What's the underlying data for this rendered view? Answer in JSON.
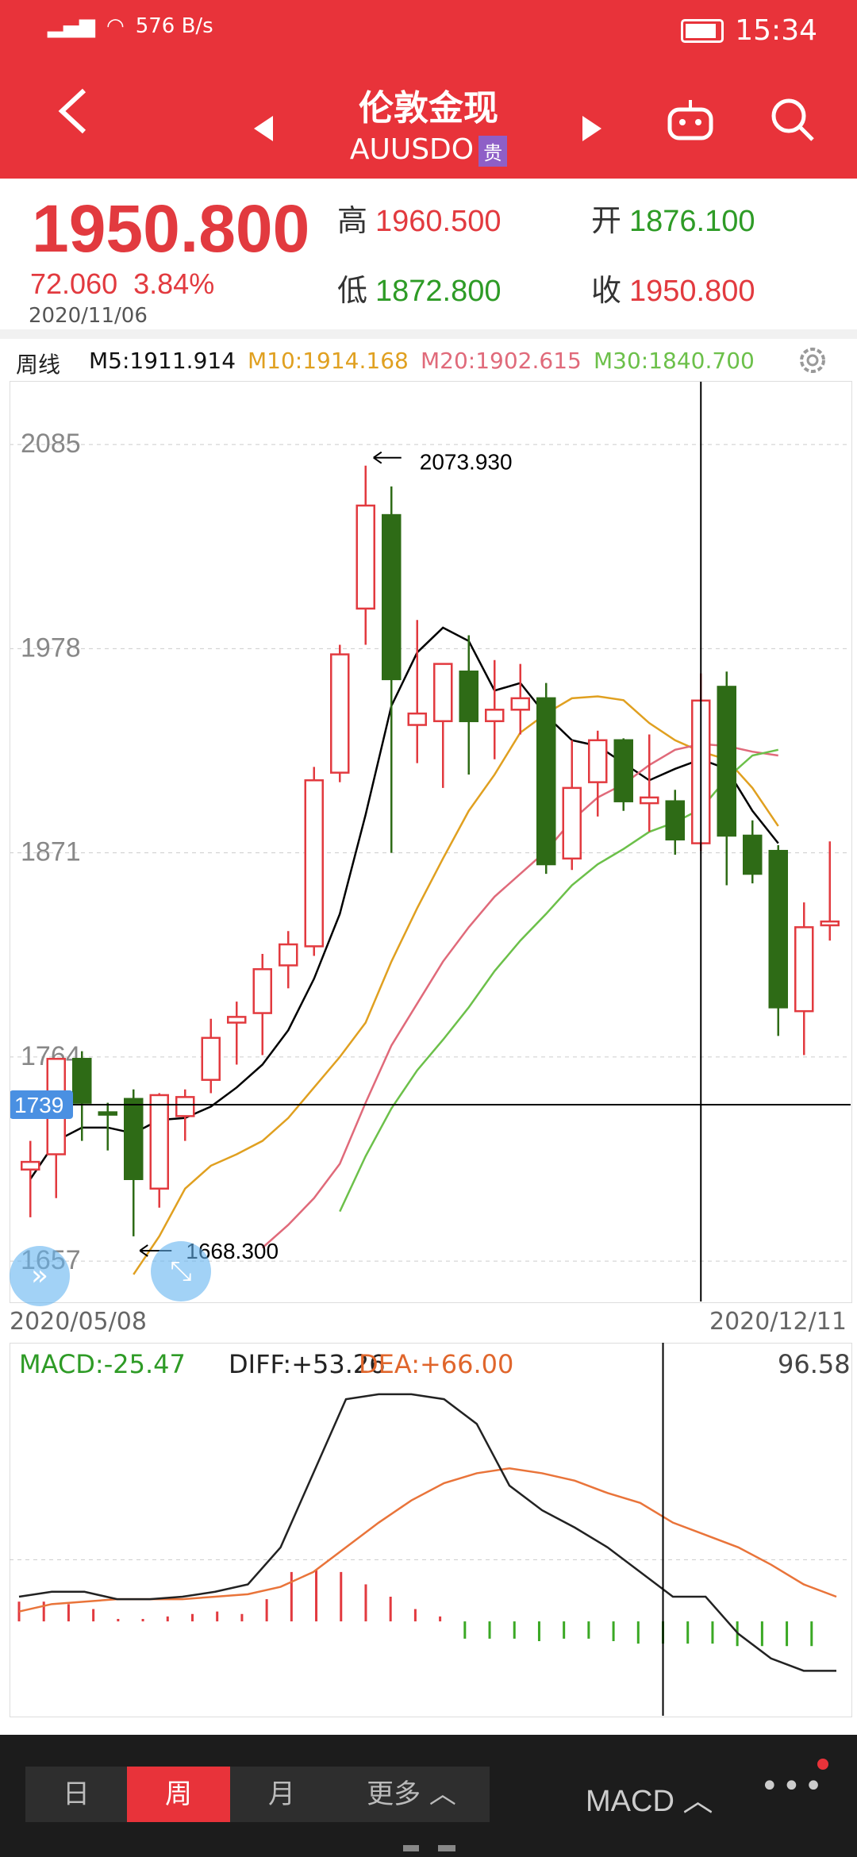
{
  "status": {
    "left_text": "576 B/s",
    "time": "15:34"
  },
  "header": {
    "title": "伦敦金现",
    "symbol": "AUUSDO",
    "badge": "贵"
  },
  "quote": {
    "last": "1950.800",
    "change": "72.060",
    "change_pct": "3.84%",
    "date": "2020/11/06",
    "high_label": "高",
    "high": "1960.500",
    "open_label": "开",
    "open": "1876.100",
    "low_label": "低",
    "low": "1872.800",
    "close_label": "收",
    "close": "1950.800"
  },
  "ma_bar": {
    "period": "周线",
    "m5": "M5:1911.914",
    "m10": "M10:1914.168",
    "m20": "M20:1902.615",
    "m30": "M30:1840.700"
  },
  "colors": {
    "brand": "#e8333a",
    "up": "#e23a3f",
    "down": "#2e6b16",
    "m5": "#000000",
    "m10": "#e0a020",
    "m20": "#e06a7a",
    "m30": "#6cc04a"
  },
  "chart_data": [
    {
      "type": "candlestick",
      "ylim": [
        1640,
        2110
      ],
      "y_ticks": [
        2085,
        1978,
        1871,
        1764,
        1657
      ],
      "x_start": "2020/05/08",
      "x_end": "2020/12/11",
      "crosshair_price": "1739",
      "max_label": "2073.930",
      "min_label": "1668.300",
      "candles": [
        {
          "o": 1705,
          "h": 1720,
          "l": 1680,
          "c": 1709
        },
        {
          "o": 1713,
          "h": 1760,
          "l": 1690,
          "c": 1763
        },
        {
          "o": 1763,
          "h": 1767,
          "l": 1720,
          "c": 1740
        },
        {
          "o": 1735,
          "h": 1740,
          "l": 1715,
          "c": 1734
        },
        {
          "o": 1742,
          "h": 1747,
          "l": 1670,
          "c": 1700
        },
        {
          "o": 1695,
          "h": 1745,
          "l": 1685,
          "c": 1744
        },
        {
          "o": 1733,
          "h": 1747,
          "l": 1720,
          "c": 1743
        },
        {
          "o": 1752,
          "h": 1784,
          "l": 1745,
          "c": 1774
        },
        {
          "o": 1782,
          "h": 1793,
          "l": 1760,
          "c": 1785
        },
        {
          "o": 1787,
          "h": 1818,
          "l": 1765,
          "c": 1810
        },
        {
          "o": 1812,
          "h": 1830,
          "l": 1800,
          "c": 1823
        },
        {
          "o": 1822,
          "h": 1916,
          "l": 1817,
          "c": 1909
        },
        {
          "o": 1913,
          "h": 1980,
          "l": 1908,
          "c": 1975
        },
        {
          "o": 1999,
          "h": 2073.93,
          "l": 1980,
          "c": 2053
        },
        {
          "o": 2048,
          "h": 2063,
          "l": 1871,
          "c": 1962
        },
        {
          "o": 1938,
          "h": 1993,
          "l": 1918,
          "c": 1944
        },
        {
          "o": 1940,
          "h": 1960,
          "l": 1905,
          "c": 1970
        },
        {
          "o": 1966,
          "h": 1985,
          "l": 1912,
          "c": 1940
        },
        {
          "o": 1940,
          "h": 1972,
          "l": 1920,
          "c": 1946
        },
        {
          "o": 1946,
          "h": 1970,
          "l": 1933,
          "c": 1952
        },
        {
          "o": 1952,
          "h": 1960,
          "l": 1860,
          "c": 1865
        },
        {
          "o": 1868,
          "h": 1930,
          "l": 1862,
          "c": 1905
        },
        {
          "o": 1908,
          "h": 1935,
          "l": 1890,
          "c": 1930
        },
        {
          "o": 1930,
          "h": 1931,
          "l": 1893,
          "c": 1898
        },
        {
          "o": 1897,
          "h": 1933,
          "l": 1882,
          "c": 1900
        },
        {
          "o": 1898,
          "h": 1904,
          "l": 1870,
          "c": 1878
        },
        {
          "o": 1876,
          "h": 1965,
          "l": 1872,
          "c": 1950.8
        },
        {
          "o": 1958,
          "h": 1966,
          "l": 1854,
          "c": 1880
        },
        {
          "o": 1880,
          "h": 1888,
          "l": 1855,
          "c": 1860
        },
        {
          "o": 1872,
          "h": 1875,
          "l": 1775,
          "c": 1790
        },
        {
          "o": 1788,
          "h": 1845,
          "l": 1765,
          "c": 1832
        },
        {
          "o": 1833,
          "h": 1877,
          "l": 1825,
          "c": 1835
        }
      ],
      "series": [
        {
          "name": "M5",
          "values": [
            1700,
            1720,
            1727,
            1727,
            1724,
            1731,
            1732,
            1738,
            1748,
            1760,
            1778,
            1805,
            1839,
            1891,
            1948,
            1976,
            1989,
            1982,
            1956,
            1960,
            1943,
            1930,
            1927,
            1918,
            1909,
            1915,
            1920,
            1915,
            1893,
            1876
          ]
        },
        {
          "name": "M10",
          "values": [
            null,
            null,
            null,
            null,
            1650,
            1670,
            1695,
            1707,
            1713,
            1720,
            1732,
            1748,
            1764,
            1782,
            1814,
            1842,
            1868,
            1893,
            1912,
            1934,
            1944,
            1952,
            1953,
            1951,
            1939,
            1930,
            1924,
            1920,
            1905,
            1885
          ]
        },
        {
          "name": "M20",
          "values": [
            null,
            null,
            null,
            null,
            null,
            null,
            null,
            null,
            null,
            1664,
            1676,
            1690,
            1708,
            1740,
            1770,
            1792,
            1814,
            1832,
            1848,
            1860,
            1872,
            1888,
            1900,
            1907,
            1917,
            1925,
            1928,
            1927,
            1924,
            1922
          ]
        },
        {
          "name": "M30",
          "values": [
            null,
            null,
            null,
            null,
            null,
            null,
            null,
            null,
            null,
            null,
            null,
            null,
            1683,
            1712,
            1737,
            1757,
            1773,
            1790,
            1809,
            1825,
            1839,
            1854,
            1865,
            1873,
            1882,
            1887,
            1894,
            1910,
            1922,
            1925
          ]
        }
      ]
    },
    {
      "type": "macd",
      "title": "MACD:-25.47",
      "diff_label": "DIFF:+53.26",
      "dea_label": "DEA:+66.00",
      "top_value": "96.58",
      "ylim": [
        -35,
        100
      ],
      "diff": [
        10,
        12,
        12,
        9,
        9,
        10,
        12,
        15,
        30,
        60,
        90,
        92,
        92,
        90,
        80,
        55,
        45,
        38,
        30,
        20,
        10,
        10,
        -5,
        -15,
        -20,
        -20
      ],
      "dea": [
        4,
        7,
        8,
        9,
        9,
        9,
        10,
        11,
        14,
        20,
        30,
        40,
        49,
        56,
        60,
        62,
        60,
        57,
        52,
        48,
        40,
        35,
        30,
        23,
        15,
        10
      ],
      "histogram": [
        8,
        8,
        7,
        5,
        1,
        1,
        2,
        3,
        4,
        3,
        9,
        20,
        21,
        20,
        15,
        10,
        5,
        2,
        -7,
        -7,
        -7,
        -8,
        -7,
        -7,
        -8,
        -9,
        -9,
        -9,
        -9,
        -10,
        -10,
        -10,
        -10
      ]
    }
  ],
  "bottom": {
    "tab_day": "日",
    "tab_week": "周",
    "tab_month": "月",
    "tab_more": "更多",
    "indicator": "MACD",
    "more_dots": "•••"
  }
}
